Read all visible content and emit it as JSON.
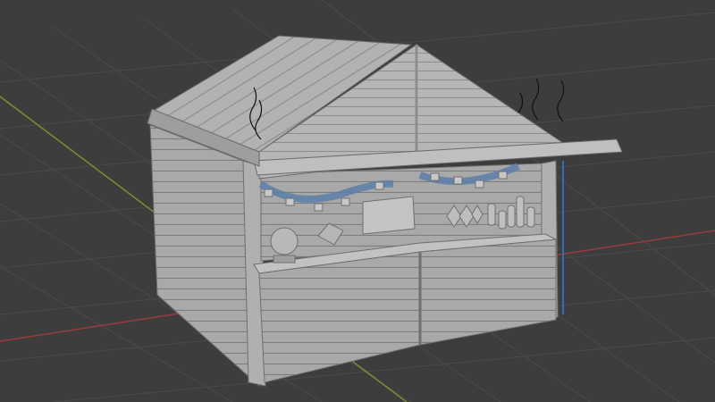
{
  "viewport": {
    "background": "#3d3d3d",
    "grid_color": "#4a4a4a",
    "x_axis_color": "#9a3b3b",
    "y_axis_color": "#7b8f2e"
  },
  "model": {
    "object": "market-stall",
    "wood_color": "#a8a8a8",
    "wood_dark": "#8a8a8a",
    "wood_light": "#c0c0c0",
    "garland_color": "#5a7fa8",
    "edge_color": "#2f6fb0"
  }
}
